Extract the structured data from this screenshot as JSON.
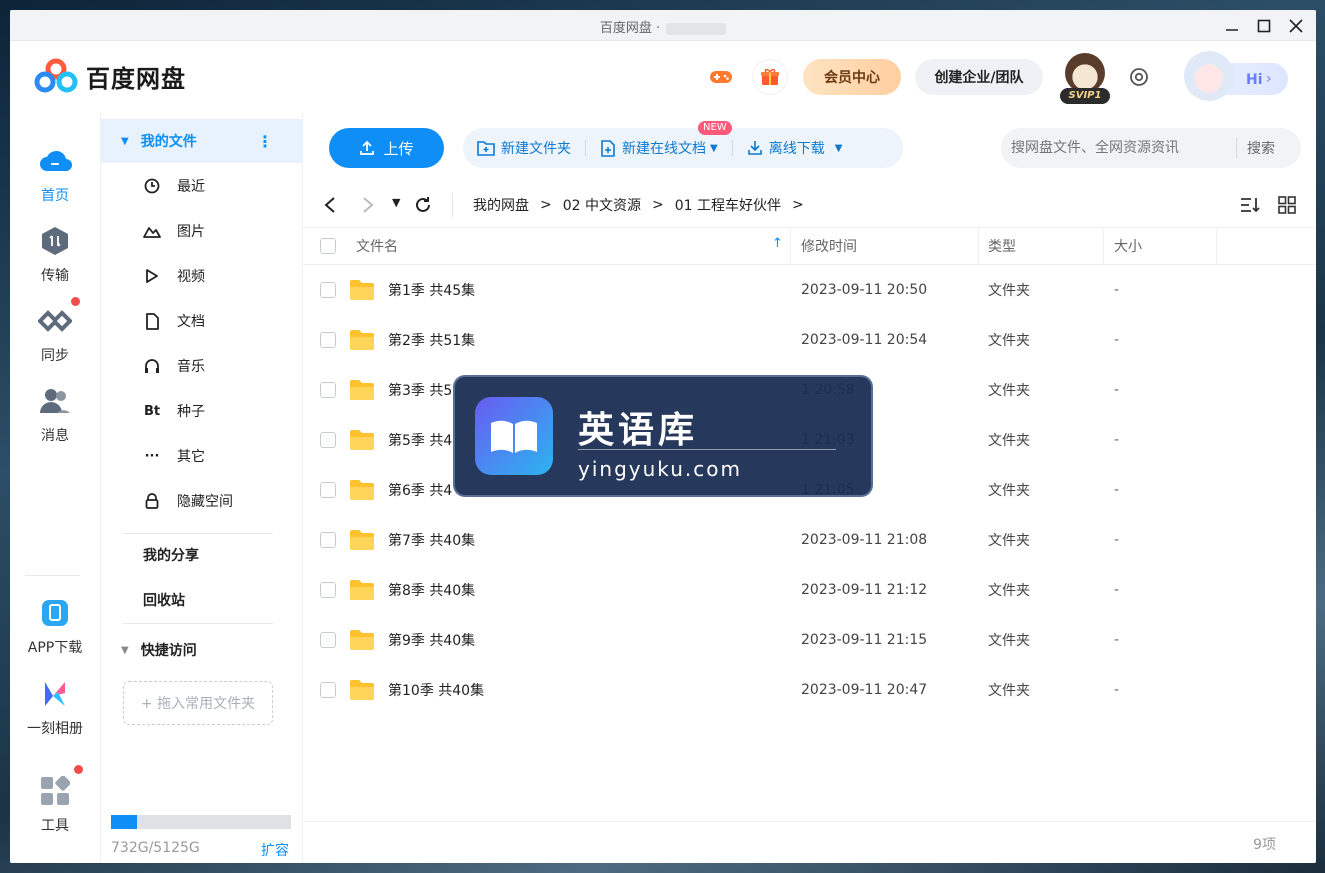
{
  "window": {
    "title": "百度网盘 ·"
  },
  "header": {
    "logo_text": "百度网盘",
    "vip_center": "会员中心",
    "enterprise": "创建企业/团队",
    "svip_badge": "SVIP1",
    "hi_label": "Hi"
  },
  "leftnav": {
    "items": [
      {
        "label": "首页",
        "icon": "cloud-home-icon"
      },
      {
        "label": "传输",
        "icon": "transfer-icon"
      },
      {
        "label": "同步",
        "icon": "sync-icon"
      },
      {
        "label": "消息",
        "icon": "message-icon"
      },
      {
        "label": "APP下载",
        "icon": "phone-icon"
      },
      {
        "label": "一刻相册",
        "icon": "album-icon"
      },
      {
        "label": "工具",
        "icon": "tools-icon"
      }
    ],
    "active_color": "#0f8ef5"
  },
  "panel": {
    "my_files": "我的文件",
    "items": [
      {
        "label": "最近",
        "icon": "clock-icon"
      },
      {
        "label": "图片",
        "icon": "image-icon"
      },
      {
        "label": "视频",
        "icon": "play-icon"
      },
      {
        "label": "文档",
        "icon": "document-icon"
      },
      {
        "label": "音乐",
        "icon": "headphones-icon"
      },
      {
        "label": "种子",
        "icon": "bt-icon",
        "glyph": "Bt"
      },
      {
        "label": "其它",
        "icon": "more-icon"
      },
      {
        "label": "隐藏空间",
        "icon": "lock-icon"
      }
    ],
    "my_share": "我的分享",
    "recycle": "回收站",
    "quick_access": "快捷访问",
    "drop_hint": "+ 拖入常用文件夹",
    "storage": {
      "used_text": "732G/5125G",
      "used_fraction": 0.143,
      "expand": "扩容"
    }
  },
  "toolbar": {
    "upload": "上传",
    "new_folder": "新建文件夹",
    "new_online_doc": "新建在线文档",
    "new_badge": "NEW",
    "offline_download": "离线下载",
    "search_placeholder": "搜网盘文件、全网资源资讯",
    "search_button": "搜索"
  },
  "breadcrumb": [
    "我的网盘",
    "02 中文资源",
    "01 工程车好伙伴"
  ],
  "table": {
    "headers": {
      "name": "文件名",
      "modified": "修改时间",
      "type": "类型",
      "size": "大小"
    },
    "rows": [
      {
        "name": "第1季 共45集",
        "modified": "2023-09-11 20:50",
        "type": "文件夹",
        "size": "-"
      },
      {
        "name": "第2季 共51集",
        "modified": "2023-09-11 20:54",
        "type": "文件夹",
        "size": "-"
      },
      {
        "name": "第3季 共5",
        "modified": "1 20:58",
        "type": "文件夹",
        "size": "-"
      },
      {
        "name": "第5季 共4",
        "modified": "1 21:03",
        "type": "文件夹",
        "size": "-"
      },
      {
        "name": "第6季 共4",
        "modified": "1 21:05",
        "type": "文件夹",
        "size": "-"
      },
      {
        "name": "第7季 共40集",
        "modified": "2023-09-11 21:08",
        "type": "文件夹",
        "size": "-"
      },
      {
        "name": "第8季 共40集",
        "modified": "2023-09-11 21:12",
        "type": "文件夹",
        "size": "-"
      },
      {
        "name": "第9季 共40集",
        "modified": "2023-09-11 21:15",
        "type": "文件夹",
        "size": "-"
      },
      {
        "name": "第10季 共40集",
        "modified": "2023-09-11 20:47",
        "type": "文件夹",
        "size": "-"
      }
    ]
  },
  "footer": {
    "count": "9项"
  },
  "watermark": {
    "title": "英语库",
    "url": "yingyuku.com"
  }
}
